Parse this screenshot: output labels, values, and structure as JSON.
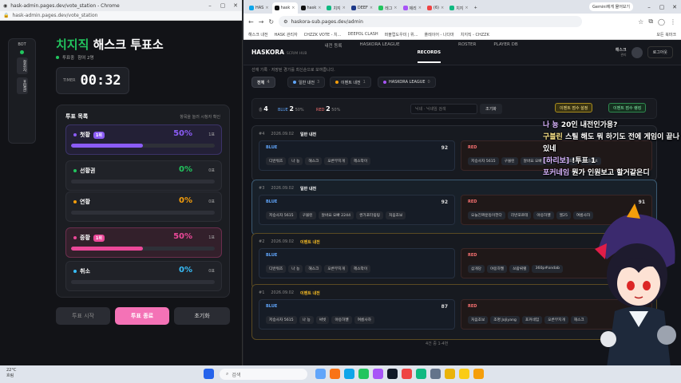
{
  "left_window": {
    "title": "hask-admin.pages.dev/vote_station - Chrome",
    "url": "hask-admin.pages.dev/vote_station",
    "sidebar": {
      "label": "BOT",
      "items": [
        "청취자",
        "포털관"
      ]
    },
    "header": {
      "title_accent": "치지직",
      "title_rest": " 해스크 투표소",
      "status": "투표중",
      "participants": "참여 2명"
    },
    "timer": {
      "label": "TIMER",
      "value": "00:32"
    },
    "vote_list": {
      "title": "투표 목록",
      "hint": "항목을 눌러 시청자 확인",
      "options": [
        {
          "name": "첫황",
          "rank": "1위",
          "percent": "50%",
          "count": "1표",
          "fraction": 0.5,
          "color": "#8b5cf6"
        },
        {
          "name": "선황권",
          "rank": "",
          "percent": "0%",
          "count": "0표",
          "fraction": 0,
          "color": "#22c55e"
        },
        {
          "name": "연황",
          "rank": "",
          "percent": "0%",
          "count": "0표",
          "fraction": 0,
          "color": "#f59e0b"
        },
        {
          "name": "중황",
          "rank": "1위",
          "percent": "50%",
          "count": "1표",
          "fraction": 0.5,
          "color": "#ec4899"
        },
        {
          "name": "취소",
          "rank": "",
          "percent": "0%",
          "count": "0표",
          "fraction": 0,
          "color": "#38bdf8"
        }
      ]
    },
    "buttons": {
      "start": "투표 시작",
      "end": "투표 종료",
      "reset": "초기화"
    }
  },
  "right_window": {
    "tabs": [
      "HAS",
      "hask",
      "hask",
      "치지",
      "DEEF",
      "레그",
      "제리",
      "(6)",
      "치지"
    ],
    "gemini": "Gemini에게 물어보기",
    "url": "haskora-sub.pages.dev/admin",
    "bookmarks": [
      "해스크 내전",
      "HASK 관리자",
      "CHZZK VOTE - 치...",
      "DEEPOL CLASH",
      "퍼블럽도우미 | 위...",
      "플레이어 - 나다마",
      "치지직 - CHZZK",
      "모든 북마크"
    ],
    "app": {
      "brand": "HASKORA",
      "brand_sub": "SCRIM HUB",
      "nav": [
        "내전 등록",
        "HASKORA LEAGUE",
        "RECORDS",
        "ROSTER",
        "PLAYER DB"
      ],
      "active_nav": "RECORDS",
      "user": "해스크",
      "user_role": "관리",
      "logout": "로그아웃",
      "subline": "선재 기록 · 저장된 경기를 최신순으로 보여줍니다.",
      "filters": [
        {
          "label": "전체",
          "count": "4"
        },
        {
          "label": "일반 내전",
          "count": "3"
        },
        {
          "label": "이벤트 내전",
          "count": "1"
        },
        {
          "label": "HASKORA LEAGUE",
          "count": "0"
        }
      ],
      "stats": {
        "total_label": "총",
        "total": "4",
        "blue_label": "BLUE",
        "blue": "2",
        "blue_pct": "50%",
        "red_label": "RED",
        "red": "2",
        "red_pct": "50%"
      },
      "search_placeholder": "닉네 · 닉네임 검색",
      "search_btn": "조기화",
      "event_badges": [
        "이벤트 점수 설정",
        "이벤트 점수 랭킹"
      ],
      "matches": [
        {
          "idx": "#4",
          "date": "2026.09.02",
          "type": "일반 내전",
          "blue": {
            "label": "BLUE",
            "score": "92",
            "players": [
              "디반워즈",
              "나 뇽",
              "해스크",
              "오른무지개",
              "헤스악이"
            ]
          },
          "red": {
            "label": "RED",
            "score": "",
            "players": [
              "저승사자 5615",
              "구블린",
              "알바요 오빠 2244",
              "쌍가포터",
              "처음조보"
            ]
          }
        },
        {
          "idx": "#3",
          "date": "2026.09.02",
          "type": "일반 내전",
          "blue": {
            "label": "BLUE",
            "score": "92",
            "players": [
              "저승사자 5615",
              "구블린",
              "알바요 오빠 2244",
              "쌍가포터링링",
              "처음조보"
            ]
          },
          "red": {
            "label": "RED",
            "score": "91",
            "players": [
              "오늘진짜운동이한다",
              "리반포르테",
              "야옹하멜",
              "엘25",
              "여름사하"
            ]
          }
        },
        {
          "idx": "#2",
          "date": "2026.09.02",
          "type": "이벤트 내전",
          "blue": {
            "label": "BLUE",
            "score": "",
            "players": [
              "디반워즈",
              "나 뇽",
              "해스크",
              "오른무지개",
              "헤스악이"
            ]
          },
          "red": {
            "label": "RED",
            "score": "",
            "players": [
              "삼개당",
              "야옹하멜",
              "쓰람뤼렐",
              "360p#ondab"
            ]
          }
        },
        {
          "idx": "#1",
          "date": "2026.09.02",
          "type": "이벤트 내전",
          "blue": {
            "label": "BLUE",
            "score": "87",
            "players": [
              "저승사자 5615",
              "나 뇽",
              "써빗",
              "야옹하멜",
              "여름사하"
            ]
          },
          "red": {
            "label": "RED",
            "score": "",
            "players": [
              "처음조보",
              "조명 JoJiyang",
              "포커네임",
              "오른무지개",
              "해스크"
            ]
          }
        }
      ],
      "pager": "4건 중 1-4번"
    }
  },
  "chat": [
    {
      "name": "나 뇽",
      "msg": " 20인 내전인가용?"
    },
    {
      "name": "구블린",
      "msg": " 스틸 해도 뭐 하기도 전에 게임이 끝나있네"
    },
    {
      "name": "[하리보]",
      "msg": " !투표 1"
    },
    {
      "name": "포커네임",
      "msg": " 뭔가 인원보고 할거같은디"
    }
  ],
  "taskbar": {
    "weather_temp": "22°C",
    "weather_desc": "흐림",
    "search": "검색"
  }
}
